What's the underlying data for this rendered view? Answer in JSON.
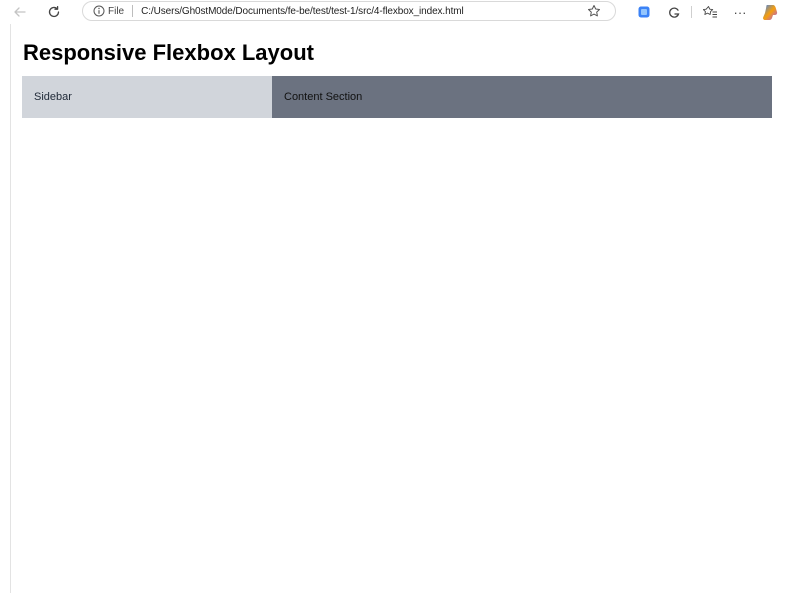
{
  "browser": {
    "file_label": "File",
    "url": "C:/Users/Gh0stM0de/Documents/fe-be/test/test-1/src/4-flexbox_index.html",
    "menu_ellipsis": "···"
  },
  "page": {
    "title": "Responsive Flexbox Layout",
    "sidebar_label": "Sidebar",
    "content_label": "Content Section"
  },
  "colors": {
    "sidebar_bg": "#d1d5db",
    "content_bg": "#6b7280",
    "copilot_gradient": [
      "#3b82f6",
      "#f59e0b",
      "#a855f7"
    ]
  },
  "icons": [
    "back-arrow-icon",
    "refresh-icon",
    "info-icon",
    "star-icon",
    "extension-icon",
    "browser-essentials-icon",
    "favorites-icon",
    "copilot-icon"
  ]
}
